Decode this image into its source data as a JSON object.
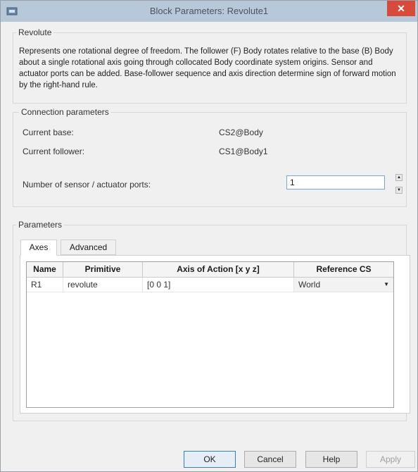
{
  "window": {
    "title": "Block Parameters: Revolute1",
    "close_glyph": "✕"
  },
  "block": {
    "name": "Revolute",
    "description": "Represents one rotational degree of freedom. The follower (F) Body rotates relative to the base (B) Body about a single rotational axis going through collocated Body coordinate system origins. Sensor and actuator ports can be added. Base-follower sequence and axis direction determine sign of forward motion by the right-hand rule."
  },
  "connection": {
    "title": "Connection parameters",
    "base_label": "Current base:",
    "base_value": "CS2@Body",
    "follower_label": "Current follower:",
    "follower_value": "CS1@Body1",
    "ports_label": "Number of sensor / actuator ports:",
    "ports_value": "1",
    "spin_up": "▲",
    "spin_down": "▼"
  },
  "parameters": {
    "title": "Parameters",
    "tabs": [
      {
        "label": "Axes",
        "active": true
      },
      {
        "label": "Advanced",
        "active": false
      }
    ],
    "columns": [
      "Name",
      "Primitive",
      "Axis of Action [x y z]",
      "Reference CS"
    ],
    "rows": [
      {
        "name": "R1",
        "primitive": "revolute",
        "axis": "[0 0 1]",
        "reference": "World"
      }
    ]
  },
  "buttons": {
    "ok": "OK",
    "cancel": "Cancel",
    "help": "Help",
    "apply": "Apply"
  }
}
